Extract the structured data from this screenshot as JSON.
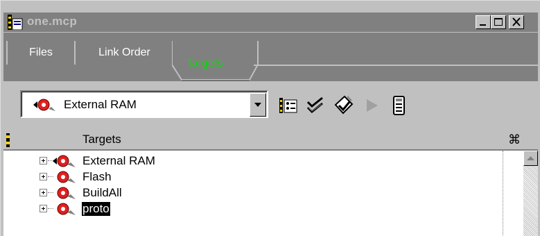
{
  "window": {
    "title": "one.mcp"
  },
  "tabs": [
    {
      "label": "Files",
      "active": false
    },
    {
      "label": "Link Order",
      "active": false
    },
    {
      "label": "Targets",
      "active": true
    }
  ],
  "toolbar": {
    "target_select": {
      "value": "External RAM"
    },
    "tools": [
      "target-settings-icon",
      "check-syntax-icon",
      "make-icon",
      "run-icon",
      "debug-icon"
    ]
  },
  "list": {
    "header": {
      "title": "Targets",
      "options_icon": "link-icon"
    },
    "items": [
      {
        "label": "External RAM",
        "active_target": true,
        "selected": false
      },
      {
        "label": "Flash",
        "active_target": false,
        "selected": false
      },
      {
        "label": "BuildAll",
        "active_target": false,
        "selected": false
      },
      {
        "label": "proto",
        "active_target": false,
        "selected": true
      }
    ]
  },
  "colors": {
    "active_tab_text": "#00e000",
    "target_icon": "#e02020",
    "titlebar_inactive": "#808080"
  }
}
